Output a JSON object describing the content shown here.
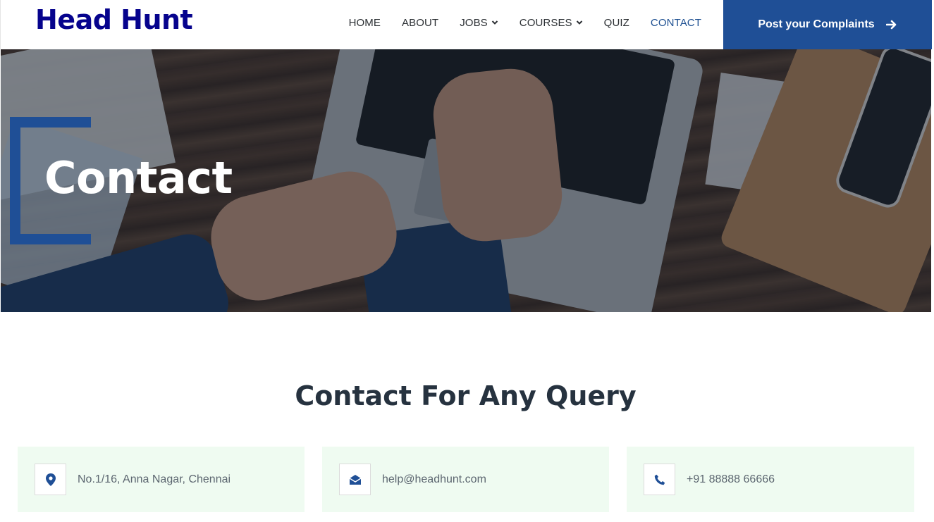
{
  "header": {
    "brand": "Head Hunt",
    "nav": [
      {
        "label": "HOME",
        "active": false,
        "dropdown": false
      },
      {
        "label": "ABOUT",
        "active": false,
        "dropdown": false
      },
      {
        "label": "JOBS",
        "active": false,
        "dropdown": true
      },
      {
        "label": "COURSES",
        "active": false,
        "dropdown": true
      },
      {
        "label": "QUIZ",
        "active": false,
        "dropdown": false
      },
      {
        "label": "CONTACT",
        "active": true,
        "dropdown": false
      }
    ],
    "cta_label": "Post your Complaints",
    "cta_icon": "arrow-right-icon"
  },
  "hero": {
    "title": "Contact"
  },
  "contact": {
    "heading": "Contact For Any Query",
    "cards": [
      {
        "icon": "map-marker-icon",
        "text": "No.1/16, Anna Nagar, Chennai"
      },
      {
        "icon": "envelope-open-icon",
        "text": "help@headhunt.com"
      },
      {
        "icon": "phone-icon",
        "text": "+91 88888 66666"
      }
    ]
  },
  "colors": {
    "brand": "#06038d",
    "primary": "#1f4f96",
    "card_bg": "#effbf1",
    "heading": "#26323f"
  }
}
